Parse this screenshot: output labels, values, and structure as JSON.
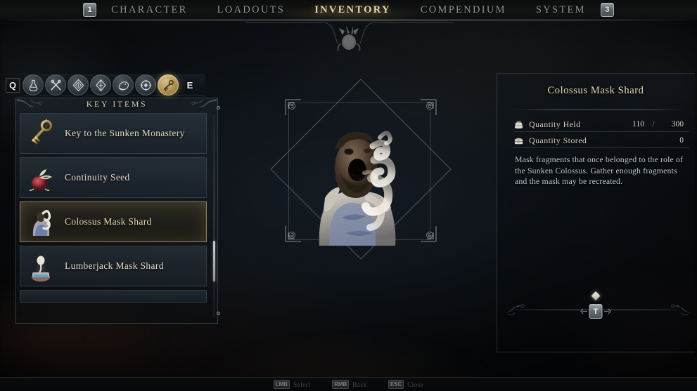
{
  "topnav": {
    "left_key": "1",
    "right_key": "3",
    "tabs": [
      {
        "label": "CHARACTER",
        "active": false
      },
      {
        "label": "LOADOUTS",
        "active": false
      },
      {
        "label": "INVENTORY",
        "active": true
      },
      {
        "label": "COMPENDIUM",
        "active": false
      },
      {
        "label": "SYSTEM",
        "active": false
      }
    ]
  },
  "category_bar": {
    "prev_key": "Q",
    "next_key": "E",
    "icons": [
      {
        "name": "potion-icon",
        "selected": false
      },
      {
        "name": "crossed-tools-icon",
        "selected": false
      },
      {
        "name": "shield-crest-icon",
        "selected": false
      },
      {
        "name": "split-orb-icon",
        "selected": false
      },
      {
        "name": "creature-icon",
        "selected": false
      },
      {
        "name": "gear-ring-icon",
        "selected": false
      },
      {
        "name": "key-icon",
        "selected": true
      }
    ]
  },
  "left_panel": {
    "title": "KEY ITEMS",
    "items": [
      {
        "name": "Key to the Sunken Monastery",
        "icon": "golden-key-icon",
        "selected": false
      },
      {
        "name": "Continuity Seed",
        "icon": "red-seed-icon",
        "selected": false
      },
      {
        "name": "Colossus Mask Shard",
        "icon": "colossus-mask-icon",
        "selected": true
      },
      {
        "name": "Lumberjack Mask Shard",
        "icon": "lumberjack-mask-icon",
        "selected": false
      }
    ]
  },
  "detail_panel": {
    "title": "Colossus Mask Shard",
    "stats": [
      {
        "icon": "pouch-icon",
        "label": "Quantity Held",
        "current": "110",
        "separator": "/",
        "max": "300"
      },
      {
        "icon": "chest-icon",
        "label": "Quantity Stored",
        "current": "",
        "separator": "",
        "max": "0"
      }
    ],
    "description": "Mask fragments that once belonged to the role of the Sunken Colossus. Gather enough fragments and the mask may be recreated.",
    "action_key": "T"
  },
  "bottom_bar": {
    "hints": [
      {
        "key": "LMB",
        "label": "Select"
      },
      {
        "key": "RMB",
        "label": "Back"
      },
      {
        "key": "ESC",
        "label": "Close"
      }
    ]
  },
  "colors": {
    "accent_gold": "#e8dcae",
    "nav_inactive": "#8e9399",
    "panel_border": "#a8b2ba",
    "bg_dark": "#07090b"
  }
}
